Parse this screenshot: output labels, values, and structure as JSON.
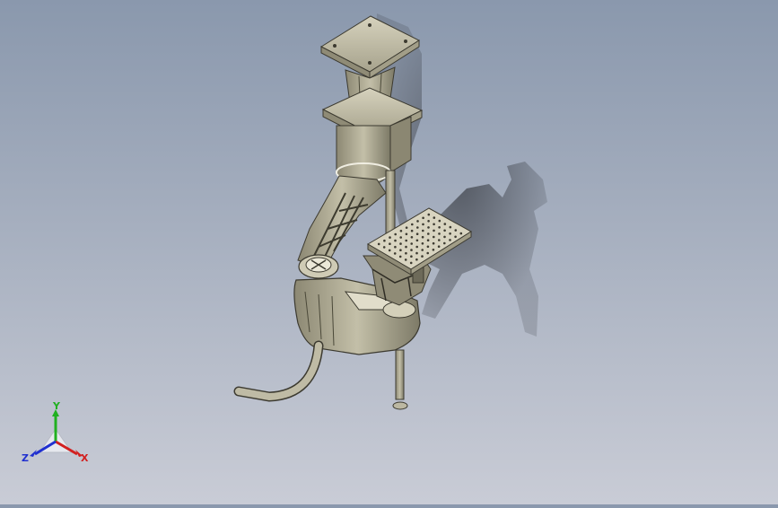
{
  "viewport": {
    "background_top": "#8a98ad",
    "background_bottom": "#c9ccd6",
    "model_color": "#b5b09a",
    "shadow_color": "#3a3d44"
  },
  "triad": {
    "x_label": "X",
    "y_label": "Y",
    "z_label": "Z",
    "x_color": "#d22020",
    "y_color": "#20b020",
    "z_color": "#2030d0"
  }
}
